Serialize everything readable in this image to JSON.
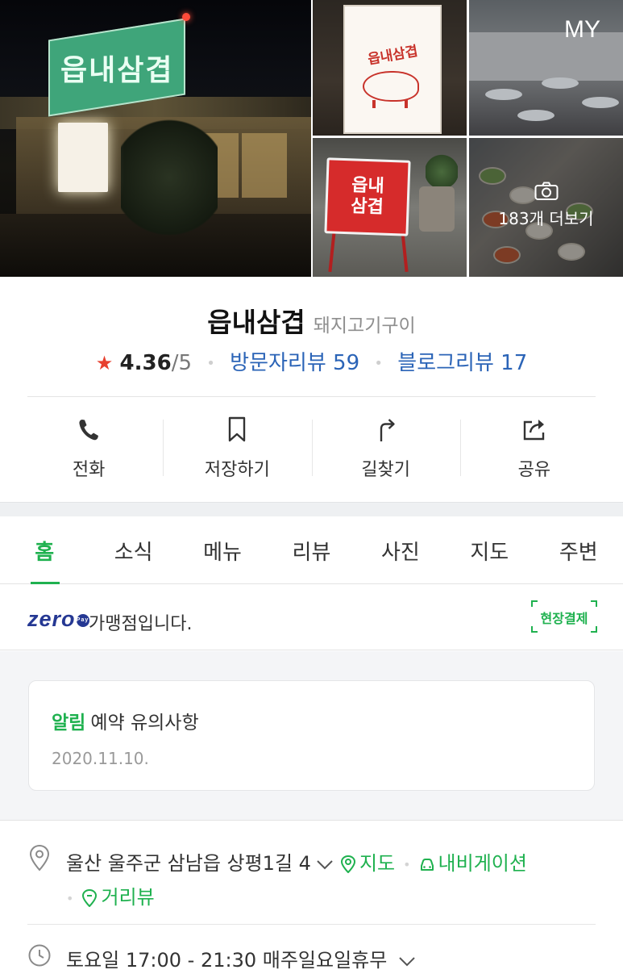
{
  "photos": {
    "main_sign_text": "읍내삼겹",
    "board_text": "읍내삼겹",
    "stand_line1": "읍내",
    "stand_line2": "삼겹",
    "my_label": "MY",
    "more_label": "183개 더보기",
    "icons": [
      "camera-icon"
    ]
  },
  "place": {
    "name": "읍내삼겹",
    "category": "돼지고기구이",
    "rating": "4.36",
    "rating_max": "/5",
    "visitor_review": "방문자리뷰 59",
    "blog_review": "블로그리뷰 17"
  },
  "actions": [
    {
      "label": "전화",
      "icon": "phone-icon"
    },
    {
      "label": "저장하기",
      "icon": "bookmark-icon"
    },
    {
      "label": "길찾기",
      "icon": "directions-icon"
    },
    {
      "label": "공유",
      "icon": "share-icon"
    }
  ],
  "tabs": [
    {
      "label": "홈",
      "active": true
    },
    {
      "label": "소식"
    },
    {
      "label": "메뉴"
    },
    {
      "label": "리뷰"
    },
    {
      "label": "사진"
    },
    {
      "label": "지도"
    },
    {
      "label": "주변"
    }
  ],
  "zeropay": {
    "logo_text": "zero",
    "logo_pay": "Pay",
    "text": "가맹점입니다.",
    "onsite_label": "현장결제"
  },
  "notice": {
    "tag": "알림",
    "title": "예약 유의사항",
    "date": "2020.11.10."
  },
  "info": {
    "address": "울산 울주군 삼남읍 상평1길 4",
    "map_link": "지도",
    "navigation_link": "내비게이션",
    "street_view_link": "거리뷰",
    "hours": "토요일 17:00 - 21:30 매주일요일휴무"
  },
  "colors": {
    "accent_green": "#1fb14f",
    "link_blue": "#2b64b7",
    "star_red": "#e7402f",
    "zeropay_navy": "#253893"
  }
}
